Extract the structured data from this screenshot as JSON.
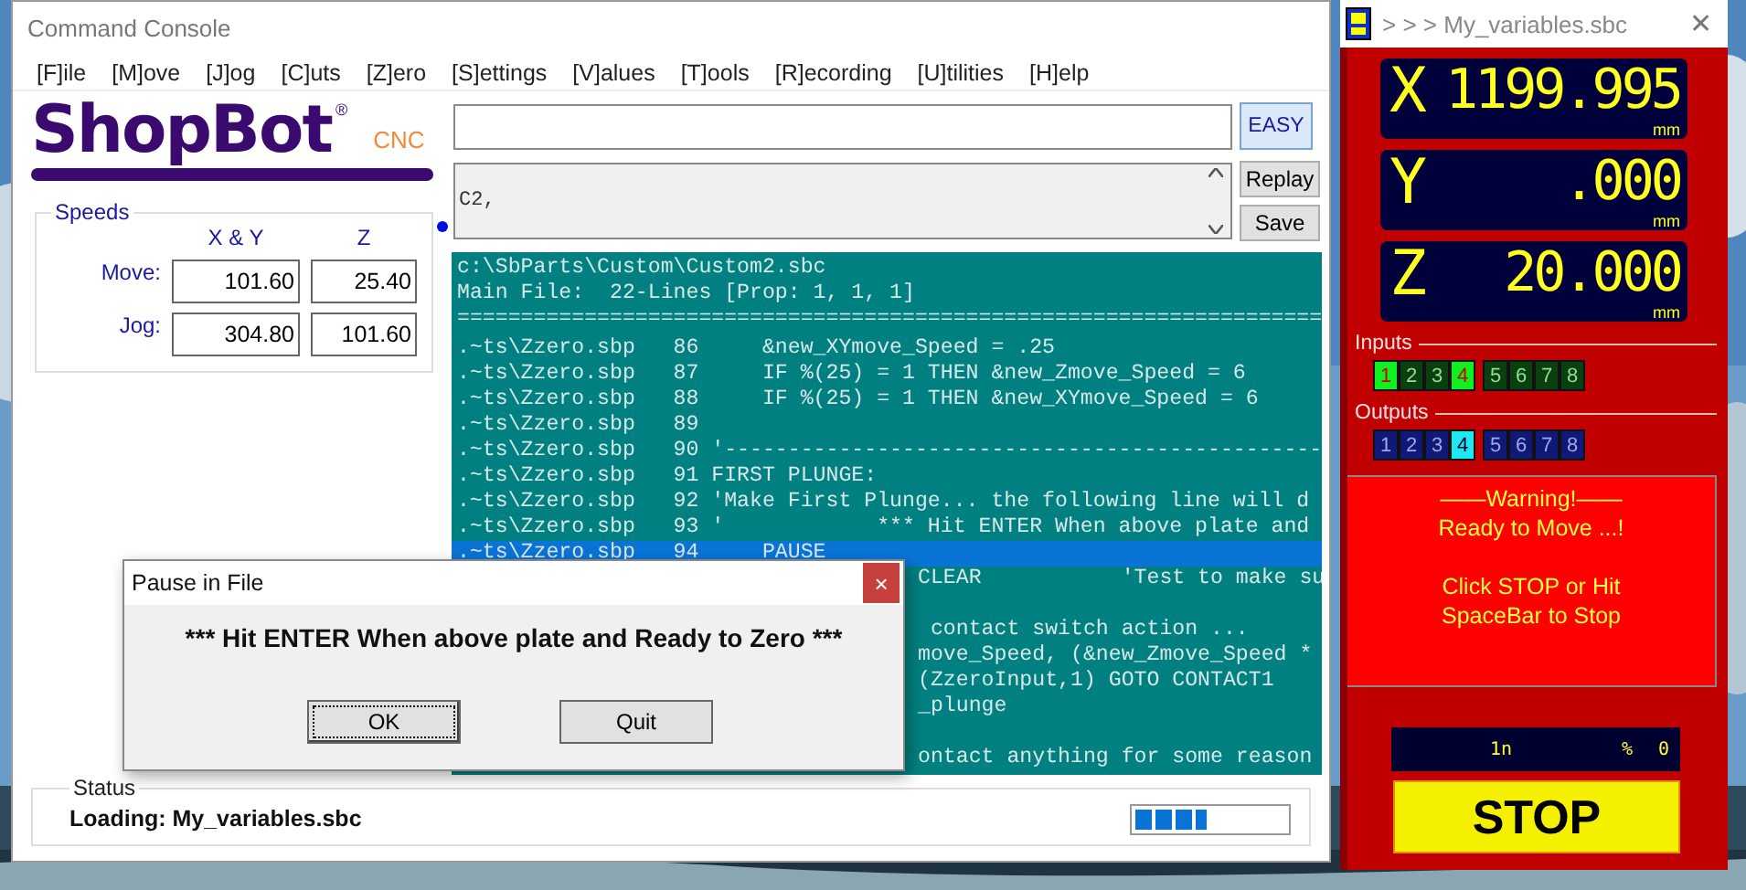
{
  "main_window": {
    "title": "Command Console",
    "menu": [
      "[F]ile",
      "[M]ove",
      "[J]og",
      "[C]uts",
      "[Z]ero",
      "[S]ettings",
      "[V]alues",
      "[T]ools",
      "[R]ecording",
      "[U]tilities",
      "[H]elp"
    ],
    "logo": {
      "name": "ShopBot",
      "mark": "®",
      "suffix": "CNC"
    },
    "easy_button": "EASY",
    "history": {
      "value": "C2,"
    },
    "replay_button": "Replay",
    "save_button": "Save",
    "speeds": {
      "title": "Speeds",
      "columns": [
        "X & Y",
        "Z"
      ],
      "rows": [
        {
          "label": "Move:",
          "values": [
            "101.60",
            "25.40"
          ]
        },
        {
          "label": "Jog:",
          "values": [
            "304.80",
            "101.60"
          ]
        }
      ]
    },
    "console": {
      "header": [
        "c:\\SbParts\\Custom\\Custom2.sbc",
        "Main File:  22-Lines [Prop: 1, 1, 1]",
        "===================================================================="
      ],
      "lines": [
        {
          "kind": "full",
          "text": ".~ts\\Zzero.sbp   86     &new_XYmove_Speed = .25",
          "selected": false
        },
        {
          "kind": "full",
          "text": ".~ts\\Zzero.sbp   87     IF %(25) = 1 THEN &new_Zmove_Speed = 6",
          "selected": false
        },
        {
          "kind": "full",
          "text": ".~ts\\Zzero.sbp   88     IF %(25) = 1 THEN &new_XYmove_Speed = 6",
          "selected": false
        },
        {
          "kind": "full",
          "text": ".~ts\\Zzero.sbp   89",
          "selected": false
        },
        {
          "kind": "full",
          "text": ".~ts\\Zzero.sbp   90 '-----------------------------------------------",
          "selected": false
        },
        {
          "kind": "full",
          "text": ".~ts\\Zzero.sbp   91 FIRST PLUNGE:",
          "selected": false
        },
        {
          "kind": "full",
          "text": ".~ts\\Zzero.sbp   92 'Make First Plunge... the following line will d",
          "selected": false
        },
        {
          "kind": "full",
          "text": ".~ts\\Zzero.sbp   93 '            *** Hit ENTER When above plate and",
          "selected": false
        },
        {
          "kind": "full",
          "text": ".~ts\\Zzero.sbp   94     PAUSE",
          "selected": true
        },
        {
          "kind": "fragment",
          "text": "CLEAR           'Test to make su",
          "selected": false
        },
        {
          "kind": "blank",
          "selected": false
        },
        {
          "kind": "fragment",
          "text": " contact switch action ...",
          "selected": false
        },
        {
          "kind": "fragment",
          "text": "move_Speed, (&new_Zmove_Speed *",
          "selected": false
        },
        {
          "kind": "fragment",
          "text": "(ZzeroInput,1) GOTO CONTACT1",
          "selected": false
        },
        {
          "kind": "fragment",
          "text": "_plunge",
          "selected": false
        },
        {
          "kind": "blank",
          "selected": false
        },
        {
          "kind": "fragment",
          "text": "ontact anything for some reason",
          "selected": false
        }
      ]
    },
    "status": {
      "title": "Status",
      "text": "Loading: My_variables.sbc",
      "level": 0.47
    }
  },
  "dialog": {
    "title": "Pause in File",
    "close": "×",
    "message": "*** Hit ENTER When above plate and Ready to Zero ***",
    "buttons": [
      {
        "label": "OK",
        "focused": true
      },
      {
        "label": "Quit",
        "focused": false
      }
    ]
  },
  "dro_window": {
    "title": "> > > My_variables.sbc",
    "close": "✕",
    "axes": [
      {
        "axis": "X",
        "value": "1199.995",
        "unit": "mm"
      },
      {
        "axis": "Y",
        "value": ".000",
        "unit": "mm"
      },
      {
        "axis": "Z",
        "value": "20.000",
        "unit": "mm"
      }
    ],
    "inputs": {
      "title": "Inputs",
      "leds": [
        {
          "label": "1",
          "on": true
        },
        {
          "label": "2",
          "on": false
        },
        {
          "label": "3",
          "on": false
        },
        {
          "label": "4",
          "on": true
        },
        {
          "label": "5",
          "on": false
        },
        {
          "label": "6",
          "on": false
        },
        {
          "label": "7",
          "on": false
        },
        {
          "label": "8",
          "on": false
        }
      ]
    },
    "outputs": {
      "title": "Outputs",
      "leds": [
        {
          "label": "1",
          "on": false
        },
        {
          "label": "2",
          "on": false
        },
        {
          "label": "3",
          "on": false
        },
        {
          "label": "4",
          "on": true
        },
        {
          "label": "5",
          "on": false
        },
        {
          "label": "6",
          "on": false
        },
        {
          "label": "7",
          "on": false
        },
        {
          "label": "8",
          "on": false
        }
      ]
    },
    "warning": [
      "——Warning!——",
      "Ready to Move ...!",
      "Click STOP or Hit",
      "SpaceBar to Stop"
    ],
    "readout": {
      "unit": "1n",
      "percent": "%",
      "value": "0"
    },
    "stop_button": "STOP"
  }
}
